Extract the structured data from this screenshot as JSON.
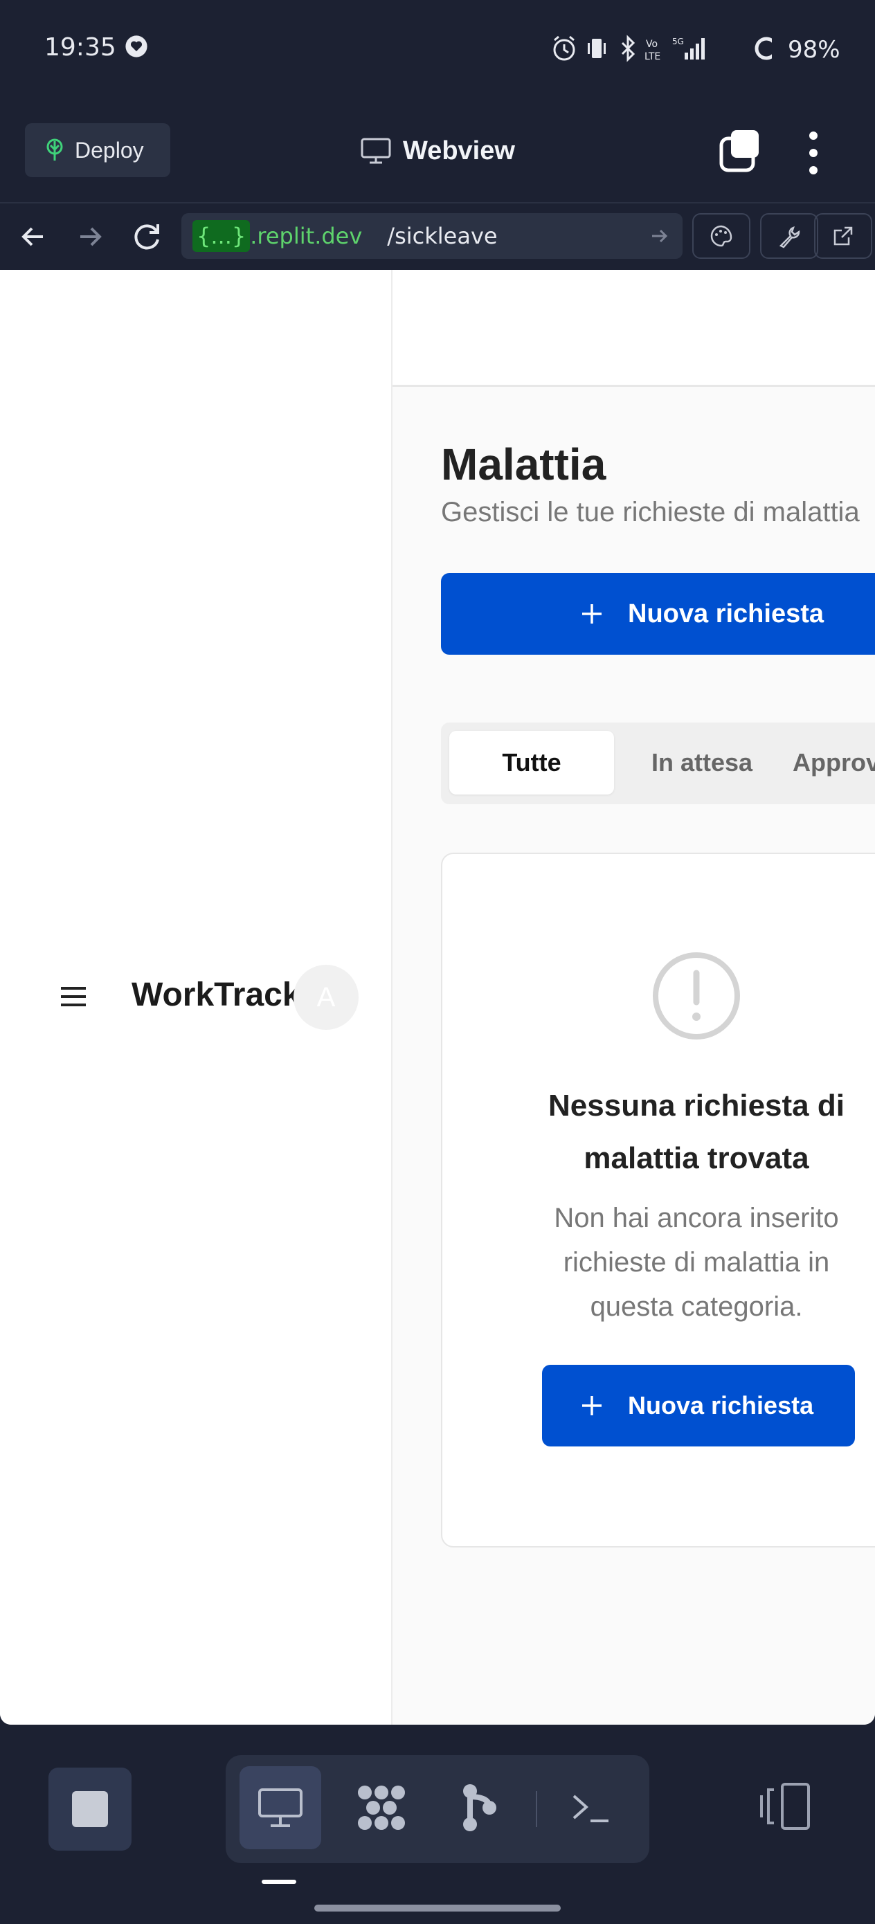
{
  "status_bar": {
    "time": "19:35",
    "battery": "98%",
    "icons": [
      "heart-icon",
      "alarm-icon",
      "vibrate-icon",
      "bluetooth-icon",
      "volte-icon",
      "5g-signal-icon",
      "battery-icon"
    ]
  },
  "toolbar": {
    "deploy_label": "Deploy",
    "title": "Webview"
  },
  "address_bar": {
    "host_tag": "{...}",
    "host": ".replit.dev",
    "path": "/sickleave"
  },
  "app": {
    "brand": "WorkTrack",
    "avatar_initial": "A"
  },
  "page": {
    "title": "Malattia",
    "subtitle": "Gestisci le tue richieste di malattia",
    "new_request_label": "Nuova richiesta"
  },
  "tabs": [
    {
      "label": "Tutte",
      "active": true
    },
    {
      "label": "In attesa",
      "active": false
    },
    {
      "label": "Approvate",
      "active": false
    }
  ],
  "empty_state": {
    "title": "Nessuna richiesta di malattia trovata",
    "description": "Non hai ancora inserito richieste di malattia in questa categoria.",
    "button_label": "Nuova richiesta"
  },
  "colors": {
    "chrome_bg": "#1c2132",
    "primary": "#0050d0",
    "host_green": "#5ed36c"
  }
}
